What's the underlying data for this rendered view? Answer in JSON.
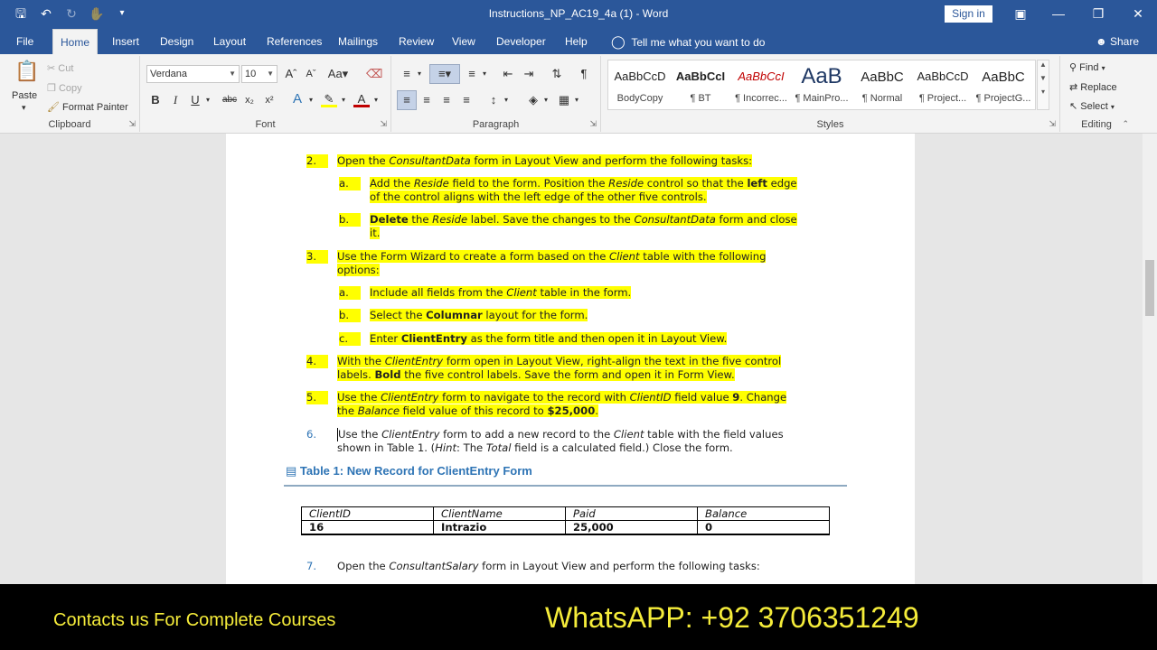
{
  "window": {
    "title": "Instructions_NP_AC19_4a (1)  -  Word",
    "sign_in": "Sign in"
  },
  "tabs": [
    {
      "label": "File"
    },
    {
      "label": "Home"
    },
    {
      "label": "Insert"
    },
    {
      "label": "Design"
    },
    {
      "label": "Layout"
    },
    {
      "label": "References"
    },
    {
      "label": "Mailings"
    },
    {
      "label": "Review"
    },
    {
      "label": "View"
    },
    {
      "label": "Developer"
    },
    {
      "label": "Help"
    }
  ],
  "tell_me": "Tell me what you want to do",
  "share": "Share",
  "clipboard": {
    "paste": "Paste",
    "cut": "Cut",
    "copy": "Copy",
    "format_painter": "Format Painter",
    "label": "Clipboard"
  },
  "font": {
    "name": "Verdana",
    "size": "10",
    "label": "Font"
  },
  "paragraph": {
    "label": "Paragraph"
  },
  "styles": {
    "label": "Styles",
    "items": [
      {
        "sample": "AaBbCcD",
        "name": "BodyCopy"
      },
      {
        "sample": "AaBbCcI",
        "name": "¶ BT"
      },
      {
        "sample": "AaBbCcI",
        "name": "¶ Incorrec..."
      },
      {
        "sample": "AaB",
        "name": "¶ MainPro..."
      },
      {
        "sample": "AaBbC",
        "name": "¶ Normal"
      },
      {
        "sample": "AaBbCcD",
        "name": "¶ Project..."
      },
      {
        "sample": "AaBbC",
        "name": "¶ ProjectG..."
      }
    ]
  },
  "editing": {
    "find": "Find",
    "replace": "Replace",
    "select": "Select",
    "label": "Editing"
  },
  "document": {
    "step2": {
      "num": "2.",
      "line1": [
        "Open the ",
        "ConsultantData",
        " form in Layout View and perform the following tasks:"
      ],
      "a_num": "a.",
      "a_line1": [
        "Add the ",
        "Reside",
        " field to the form. Position the ",
        "Reside",
        " control so that the ",
        "left",
        " edge"
      ],
      "a_line2": "of the control aligns with the left edge of the other five controls.",
      "b_num": "b.",
      "b_line1": [
        "Delete",
        " the ",
        "Reside",
        " label. Save the changes to the ",
        "ConsultantData",
        " form and close"
      ],
      "b_line2": "it."
    },
    "step3": {
      "num": "3.",
      "line1": [
        "Use the Form Wizard to create a form based on the ",
        "Client",
        " table with the following"
      ],
      "line2": "options:",
      "a_num": "a.",
      "a_line": [
        "Include all fields from the ",
        "Client",
        " table in the form."
      ],
      "b_num": "b.",
      "b_line": [
        "Select the ",
        "Columnar",
        " layout for the form."
      ],
      "c_num": "c.",
      "c_line": [
        "Enter ",
        "ClientEntry",
        " as the form title and then open it in Layout View."
      ]
    },
    "step4": {
      "num": "4.",
      "line1": [
        "With the ",
        "ClientEntry",
        " form open in Layout View, right-align the text in the five control"
      ],
      "line2": [
        "labels. ",
        "Bold",
        " the five control labels. Save the form and open it in Form View."
      ]
    },
    "step5": {
      "num": "5.",
      "line1": [
        "Use the ",
        "ClientEntry",
        " form to navigate to the record with ",
        "ClientID",
        " field value ",
        "9",
        ". Change"
      ],
      "line2": [
        "the ",
        "Balance",
        " field value of this record to ",
        "$25,000",
        "."
      ]
    },
    "step6": {
      "num": "6.",
      "line1": [
        "Use the ",
        "ClientEntry",
        " form to add a new record to the ",
        "Client",
        " table with the field values"
      ],
      "line2": [
        "shown in Table 1. (",
        "Hint",
        ": The ",
        "Total",
        " field is a calculated field.) Close the form."
      ]
    },
    "table_caption": "Table 1: New Record for ClientEntry Form",
    "table": {
      "headers": [
        "ClientID",
        "ClientName",
        "Paid",
        "Balance"
      ],
      "row": [
        "16",
        "Intrazio",
        "25,000",
        "0"
      ]
    },
    "step7": {
      "num": "7.",
      "line1": [
        "Open the ",
        "ConsultantSalary",
        " form in Layout View and perform the following tasks:"
      ]
    }
  },
  "banner": {
    "contact": "Contacts us For Complete Courses",
    "whatsapp": "WhatsAPP:  +92 3706351249"
  },
  "colors": {
    "word_blue": "#2b579a",
    "highlight": "#ffff00",
    "banner_text": "#f5ec3a",
    "caption_blue": "#2e74b5"
  }
}
